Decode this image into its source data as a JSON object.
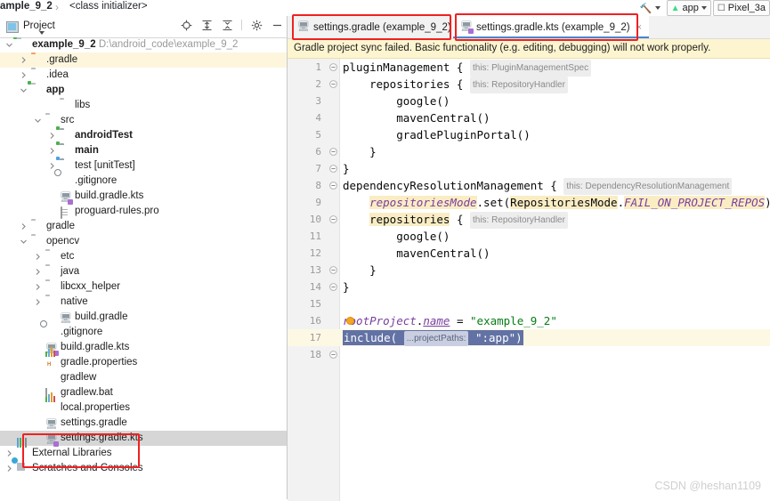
{
  "window": {
    "breadcrumb_file": "ample_9_2",
    "breadcrumb_sep": "›",
    "breadcrumb_member": "<class initializer>",
    "toolbar": {
      "build_icon": "hammer-icon",
      "run_config_label": "app",
      "run_config_icon": "android-icon",
      "device_label": "Pixel_3a",
      "device_icon": "device-icon"
    }
  },
  "project_panel": {
    "title": "Project",
    "icons": [
      "locate-icon",
      "expand-all-icon",
      "collapse-all-icon",
      "gear-icon",
      "minimize-icon"
    ],
    "tree": [
      {
        "label": "example_9_2",
        "suffix": "D:\\android_code\\example_9_2",
        "icon": "module-folder-icon",
        "arrow": "down",
        "indent": 0,
        "bold": true,
        "state": "expanded"
      },
      {
        "label": ".gradle",
        "icon": "folder-orange-icon",
        "arrow": "right",
        "indent": 1,
        "highlight": "root"
      },
      {
        "label": ".idea",
        "icon": "folder-icon",
        "arrow": "right",
        "indent": 1
      },
      {
        "label": "app",
        "icon": "module-folder-icon",
        "arrow": "down",
        "indent": 1,
        "bold": true
      },
      {
        "label": "libs",
        "icon": "folder-icon",
        "arrow": "none",
        "indent": 3
      },
      {
        "label": "src",
        "icon": "folder-icon",
        "arrow": "down",
        "indent": 2
      },
      {
        "label": "androidTest",
        "icon": "source-folder-icon",
        "arrow": "right",
        "indent": 3,
        "bold": true
      },
      {
        "label": "main",
        "icon": "source-folder-icon",
        "arrow": "right",
        "indent": 3,
        "bold": true
      },
      {
        "label": "test [unitTest]",
        "icon": "test-folder-icon",
        "arrow": "right",
        "indent": 3
      },
      {
        "label": ".gitignore",
        "icon": "gitignore-icon",
        "arrow": "none",
        "indent": 3
      },
      {
        "label": "build.gradle.kts",
        "icon": "gradle-kts-icon",
        "arrow": "none",
        "indent": 3
      },
      {
        "label": "proguard-rules.pro",
        "icon": "file-icon",
        "arrow": "none",
        "indent": 3
      },
      {
        "label": "gradle",
        "icon": "folder-icon",
        "arrow": "right",
        "indent": 1
      },
      {
        "label": "opencv",
        "icon": "folder-icon",
        "arrow": "down",
        "indent": 1
      },
      {
        "label": "etc",
        "icon": "folder-icon",
        "arrow": "right",
        "indent": 2
      },
      {
        "label": "java",
        "icon": "folder-icon",
        "arrow": "right",
        "indent": 2
      },
      {
        "label": "libcxx_helper",
        "icon": "folder-icon",
        "arrow": "right",
        "indent": 2
      },
      {
        "label": "native",
        "icon": "folder-icon",
        "arrow": "right",
        "indent": 2
      },
      {
        "label": "build.gradle",
        "icon": "gradle-icon",
        "arrow": "none",
        "indent": 3
      },
      {
        "label": ".gitignore",
        "icon": "gitignore-icon",
        "arrow": "none",
        "indent": 2
      },
      {
        "label": "build.gradle.kts",
        "icon": "gradle-kts-icon",
        "arrow": "none",
        "indent": 2
      },
      {
        "label": "gradle.properties",
        "icon": "properties-icon",
        "arrow": "none",
        "indent": 2
      },
      {
        "label": "gradlew",
        "icon": "gradlew-icon",
        "arrow": "none",
        "indent": 2
      },
      {
        "label": "gradlew.bat",
        "icon": "bat-icon",
        "arrow": "none",
        "indent": 2
      },
      {
        "label": "local.properties",
        "icon": "properties-icon",
        "arrow": "none",
        "indent": 2
      },
      {
        "label": "settings.gradle",
        "icon": "gradle-icon",
        "arrow": "none",
        "indent": 2
      },
      {
        "label": "settings.gradle.kts",
        "icon": "gradle-kts-icon",
        "arrow": "none",
        "indent": 2,
        "highlight": "selected"
      },
      {
        "label": "External Libraries",
        "icon": "external-libraries-icon",
        "arrow": "right",
        "indent": 0
      },
      {
        "label": "Scratches and Consoles",
        "icon": "scratches-icon",
        "arrow": "right",
        "indent": 0
      }
    ]
  },
  "editor": {
    "tabs": [
      {
        "label": "settings.gradle (example_9_2)",
        "icon": "gradle-icon",
        "active": false,
        "close": "×"
      },
      {
        "label": "settings.gradle.kts (example_9_2)",
        "icon": "gradle-kts-icon",
        "active": true,
        "close": "×"
      }
    ],
    "banner": "Gradle project sync failed. Basic functionality (e.g. editing, debugging) will not work properly.",
    "line_numbers": [
      "1",
      "2",
      "3",
      "4",
      "5",
      "6",
      "7",
      "8",
      "9",
      "10",
      "11",
      "12",
      "13",
      "14",
      "15",
      "16",
      "17",
      "18"
    ],
    "code_lines": [
      {
        "n": "1",
        "fold": "open",
        "text": "pluginManagement { ",
        "hint": "this: PluginManagementSpec"
      },
      {
        "n": "2",
        "fold": "open",
        "text": "    repositories { ",
        "hint": "this: RepositoryHandler"
      },
      {
        "n": "3",
        "fold": "none",
        "text": "        google()"
      },
      {
        "n": "4",
        "fold": "none",
        "text": "        mavenCentral()"
      },
      {
        "n": "5",
        "fold": "none",
        "text": "        gradlePluginPortal()"
      },
      {
        "n": "6",
        "fold": "close",
        "text": "    }"
      },
      {
        "n": "7",
        "fold": "close",
        "text": "}"
      },
      {
        "n": "8",
        "fold": "open",
        "text": "dependencyResolutionManagement { ",
        "hint": "this: DependencyResolutionManagement"
      },
      {
        "n": "9",
        "fold": "none",
        "text": "    repositoriesMode.set(RepositoriesMode.FAIL_ON_PROJECT_REPOS)"
      },
      {
        "n": "10",
        "fold": "open",
        "text": "    repositories { ",
        "hint": "this: RepositoryHandler"
      },
      {
        "n": "11",
        "fold": "none",
        "text": "        google()"
      },
      {
        "n": "12",
        "fold": "none",
        "text": "        mavenCentral()"
      },
      {
        "n": "13",
        "fold": "close",
        "text": "    }"
      },
      {
        "n": "14",
        "fold": "close",
        "text": "}"
      },
      {
        "n": "15",
        "fold": "none",
        "text": ""
      },
      {
        "n": "16",
        "fold": "none",
        "text": "rootProject.name = \"example_9_2\""
      },
      {
        "n": "17",
        "fold": "none",
        "text": "include( ...projectPaths: \":app\")",
        "selected": true
      },
      {
        "n": "18",
        "fold": "close",
        "text": ""
      }
    ],
    "l9": {
      "a": "repositoriesMode",
      "b": ".set(",
      "c": "RepositoriesMode",
      "d": ".",
      "e": "FAIL_ON_PROJECT_REPOS",
      "f": ")"
    },
    "l16": {
      "a": "rootProject",
      "b": ".",
      "c": "name",
      "d": " = ",
      "e": "\"example_9_2\""
    },
    "l17": {
      "a": "include(",
      "hint": "...projectPaths:",
      "b": "\":app\")"
    }
  },
  "annotations": {
    "redbox_tree": "settings.gradle / settings.gradle.kts files highlighted",
    "redbox_tab1": "settings.gradle tab highlighted",
    "redbox_tab2": "settings.gradle.kts tab highlighted"
  },
  "watermark": "CSDN @heshan1109",
  "colors": {
    "accent": "#4a84d0",
    "annotation_red": "#ef2121",
    "banner_bg": "#fdf5d0",
    "selection": "#6272a4",
    "string_green": "#077d17",
    "keyword_purple": "#7a3e9d"
  }
}
